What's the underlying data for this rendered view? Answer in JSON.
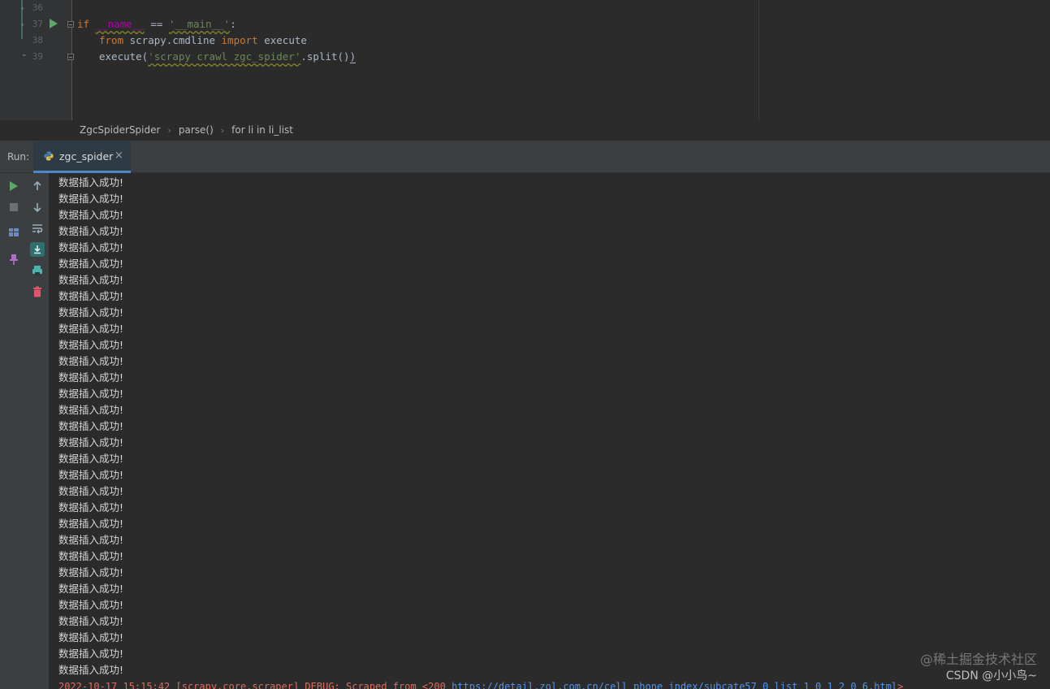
{
  "editor": {
    "line_numbers": [
      "36",
      "37",
      "38",
      "39"
    ],
    "code": {
      "line37": {
        "kw_if": "if",
        "dunder_name": "__name__",
        "op": " == ",
        "main_str": "'__main__'",
        "colon": ":"
      },
      "line38": {
        "kw_from": "from",
        "module": " scrapy.cmdline ",
        "kw_import": "import",
        "name": " execute"
      },
      "line39": {
        "call": "execute(",
        "arg_str": "'scrapy crawl zgc_spider'",
        "method": ".split()",
        "close": ")"
      }
    }
  },
  "breadcrumb": {
    "items": [
      "ZgcSpiderSpider",
      "parse()",
      "for li in li_list"
    ],
    "separator": "›"
  },
  "run_panel": {
    "label": "Run:",
    "tab": {
      "label": "zgc_spider",
      "close": "×"
    }
  },
  "console": {
    "output_lines": [
      "数据插入成功!",
      "数据插入成功!",
      "数据插入成功!",
      "数据插入成功!",
      "数据插入成功!",
      "数据插入成功!",
      "数据插入成功!",
      "数据插入成功!",
      "数据插入成功!",
      "数据插入成功!",
      "数据插入成功!",
      "数据插入成功!",
      "数据插入成功!",
      "数据插入成功!",
      "数据插入成功!",
      "数据插入成功!",
      "数据插入成功!",
      "数据插入成功!",
      "数据插入成功!",
      "数据插入成功!",
      "数据插入成功!",
      "数据插入成功!",
      "数据插入成功!",
      "数据插入成功!",
      "数据插入成功!",
      "数据插入成功!",
      "数据插入成功!",
      "数据插入成功!",
      "数据插入成功!",
      "数据插入成功!",
      "数据插入成功!"
    ],
    "log_line": {
      "prefix": "2022-10-17 15:15:42 [scrapy.core.scraper] DEBUG: Scraped from <200 ",
      "url": "https://detail.zol.com.cn/cell_phone_index/subcate57_0_list_1_0_1_2_0_6.html",
      "suffix": ">"
    }
  },
  "toolbar_left": {
    "icons": [
      "rerun-icon",
      "stop-icon",
      "layout-icon",
      "pin-icon"
    ]
  },
  "toolbar_console": {
    "icons": [
      "scroll-up-icon",
      "scroll-down-icon",
      "soft-wrap-icon",
      "scroll-to-end-icon",
      "print-icon",
      "clear-icon"
    ]
  },
  "watermark": {
    "line1": "@稀土掘金技术社区",
    "line2": "CSDN @小小鸟~"
  },
  "colors": {
    "background": "#2b2b2b",
    "panel": "#3c3f41",
    "tab_active_underline": "#4a88c7",
    "keyword": "#cc7832",
    "string": "#6a8759",
    "error_log": "#e06c5f",
    "link": "#5394ec",
    "run_green": "#59a869"
  }
}
